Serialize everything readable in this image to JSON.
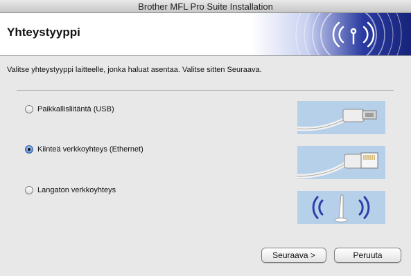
{
  "window": {
    "title": "Brother MFL Pro Suite Installation"
  },
  "header": {
    "title": "Yhteystyyppi"
  },
  "instruction": "Valitse yhteystyyppi laitteelle, jonka haluat asentaa. Valitse sitten Seuraava.",
  "options": [
    {
      "label": "Paikkallisliitäntä (USB)",
      "selected": false,
      "icon": "usb-cable-icon"
    },
    {
      "label": "Kiinteä verkkoyhteys (Ethernet)",
      "selected": true,
      "icon": "ethernet-cable-icon"
    },
    {
      "label": "Langaton verkkoyhteys",
      "selected": false,
      "icon": "wireless-antenna-icon"
    }
  ],
  "buttons": {
    "next": "Seuraava >",
    "cancel": "Peruuta"
  },
  "colors": {
    "banner": "#1f2f8f",
    "thumb_bg": "#b7d0ea",
    "wireless_wave": "#2b3fa8"
  }
}
